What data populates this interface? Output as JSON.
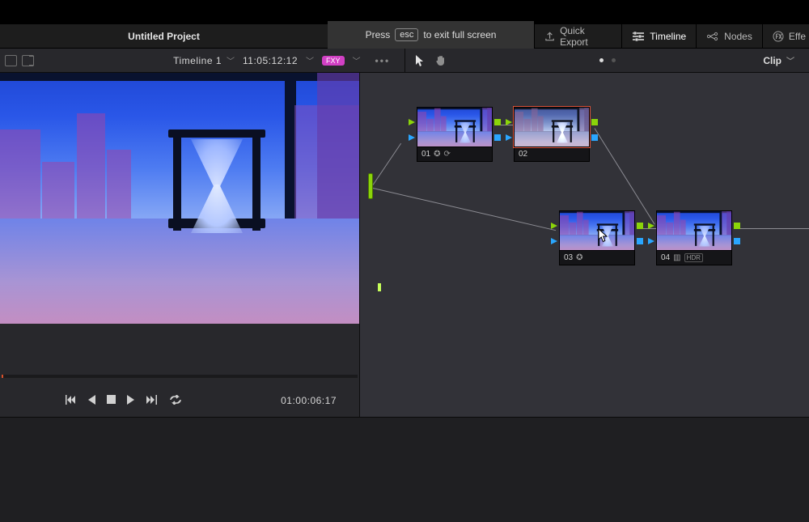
{
  "header": {
    "project_title": "Untitled Project",
    "fs_hint_pre": "Press",
    "fs_hint_key": "esc",
    "fs_hint_post": "to exit full screen",
    "menu": {
      "quick_export": "Quick Export",
      "timeline": "Timeline",
      "nodes": "Nodes",
      "effects": "Effe"
    }
  },
  "toolbar": {
    "timeline_name": "Timeline 1",
    "timecode": "11:05:12:12",
    "fxy_badge": "FXY",
    "clip_label": "Clip"
  },
  "viewer": {
    "clip_timecode": "01:00:06:17"
  },
  "nodes": {
    "n1": {
      "label": "01"
    },
    "n2": {
      "label": "02"
    },
    "n3": {
      "label": "03"
    },
    "n4": {
      "label": "04"
    }
  },
  "colors": {
    "accent_orange": "#d9533a",
    "port_video": "#8bd40a",
    "port_audio": "#2aa6ff"
  }
}
